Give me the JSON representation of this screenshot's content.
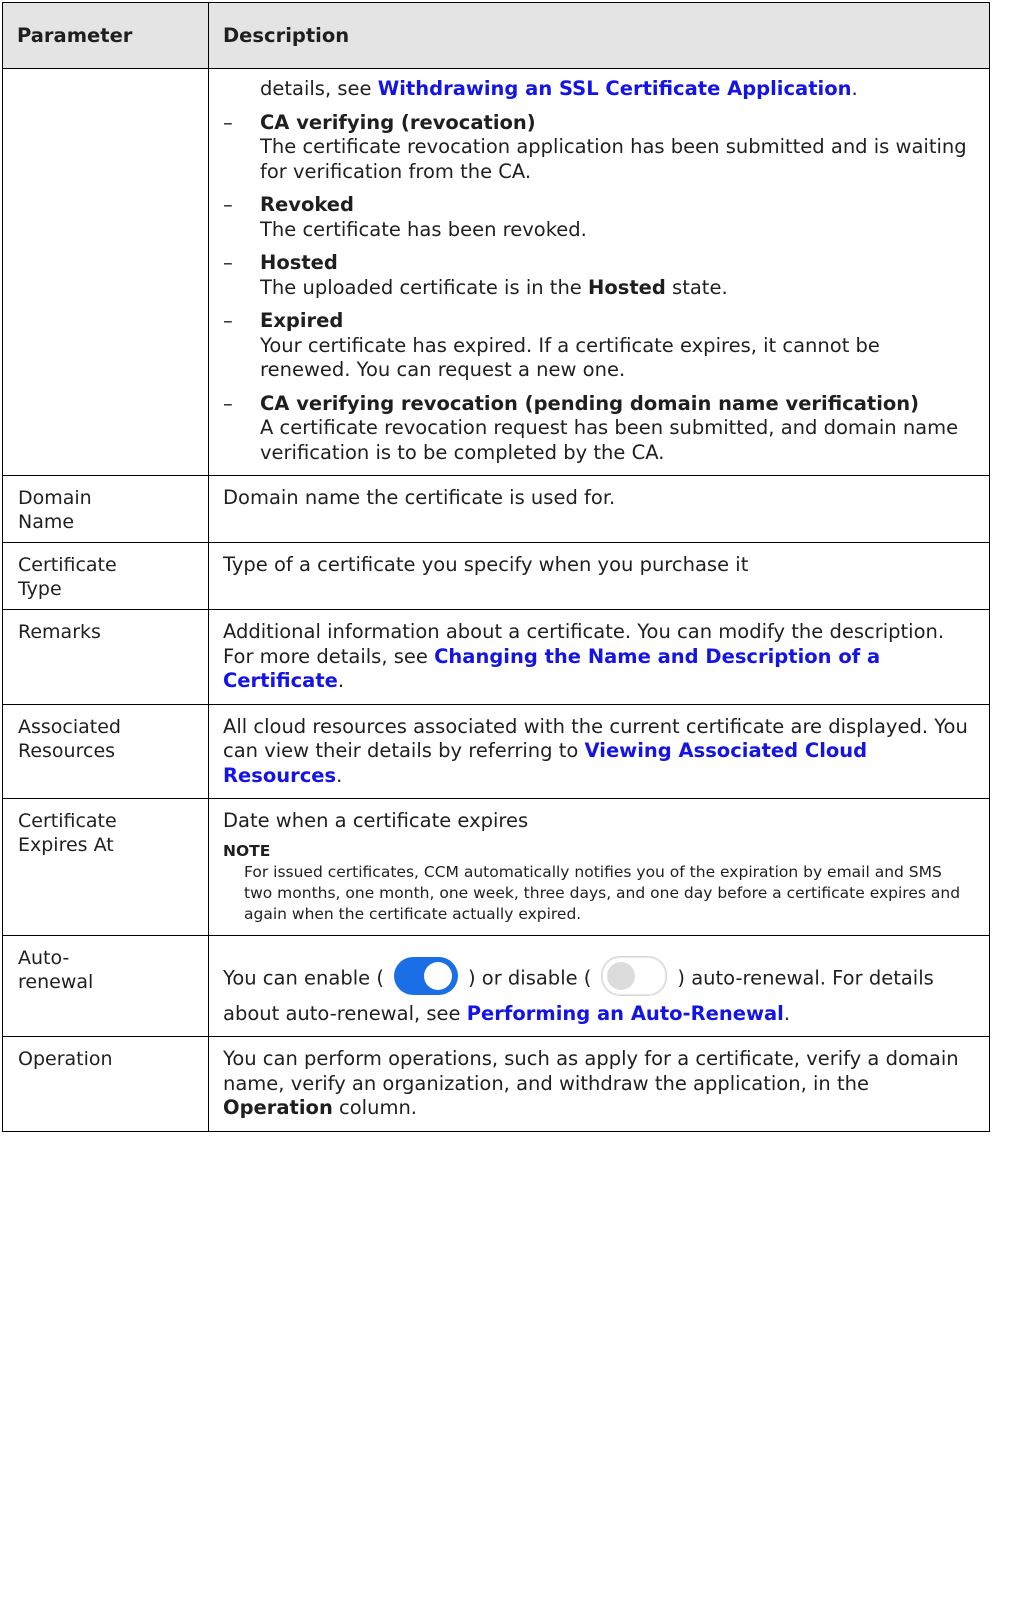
{
  "header": {
    "param": "Parameter",
    "desc": "Description"
  },
  "status": {
    "intro_prefix": "details, see ",
    "intro_link": "Withdrawing an SSL Certificate Application",
    "intro_suffix": ".",
    "dash": "–",
    "items": [
      {
        "title": "CA verifying (revocation)",
        "text": "The certificate revocation application has been submitted and is waiting for verification from the CA."
      },
      {
        "title": "Revoked",
        "text": "The certificate has been revoked."
      },
      {
        "title": "Hosted",
        "text_before": "The uploaded certificate is in the ",
        "text_bold": "Hosted",
        "text_after": " state."
      },
      {
        "title": "Expired",
        "text": "Your certificate has expired. If a certificate expires, it cannot be renewed. You can request a new one."
      },
      {
        "title": "CA verifying revocation (pending domain name verification)",
        "text": "A certificate revocation request has been submitted, and domain name verification is to be completed by the CA."
      }
    ]
  },
  "rows": {
    "domain": {
      "param_line1": "Domain",
      "param_line2": "Name",
      "desc": "Domain name the certificate is used for."
    },
    "type": {
      "param_line1": "Certificate",
      "param_line2": "Type",
      "desc": "Type of a certificate you specify when you purchase it"
    },
    "remarks": {
      "param": "Remarks",
      "desc": "Additional information about a certificate. You can modify the description. For more details, see ",
      "link": "Changing the Name and Description of a Certificate",
      "suffix": "."
    },
    "associated": {
      "param_line1": "Associated",
      "param_line2": "Resources",
      "desc": "All cloud resources associated with the current certificate are displayed. You can view their details by referring to ",
      "link": "Viewing Associated Cloud Resources",
      "suffix": "."
    },
    "expires": {
      "param_line1": "Certificate",
      "param_line2": "Expires At",
      "desc": "Date when a certificate expires",
      "note_title": "NOTE",
      "note_text": "For issued certificates, CCM automatically notifies you of the expiration by email and SMS two months, one month, one week, three days, and one day before a certificate expires and again when the certificate actually expired."
    },
    "auto_renewal": {
      "param_line1": "Auto-",
      "param_line2": "renewal",
      "text1": "You can enable (",
      "text2": ") or disable (",
      "text3": ") auto-renewal. For details about auto-renewal, see ",
      "link": "Performing an Auto-Renewal",
      "suffix": "."
    },
    "operation": {
      "param": "Operation",
      "text_before": "You can perform operations, such as apply for a certificate, verify a domain name, verify an organization, and withdraw the application, in the ",
      "text_bold": "Operation",
      "text_after": " column."
    }
  },
  "colors": {
    "link": "#1414e6",
    "header_bg": "#e4e4e4",
    "toggle_on": "#1a6fe6"
  }
}
